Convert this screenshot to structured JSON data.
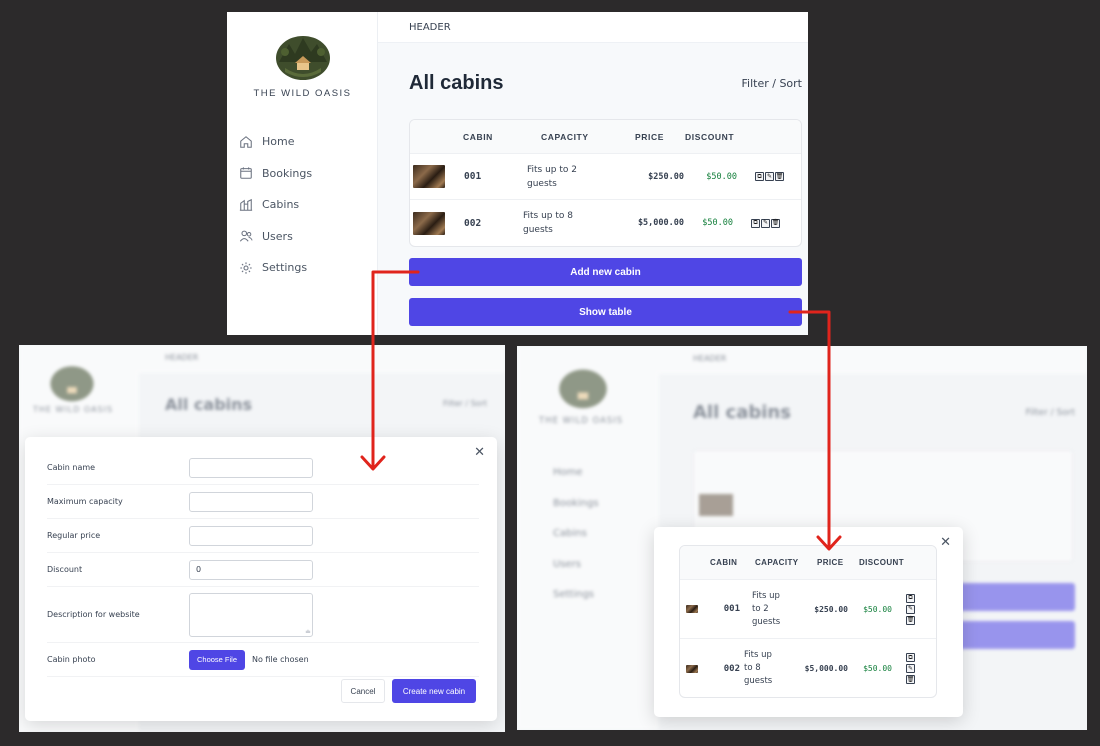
{
  "app": {
    "header": "HEADER",
    "logo_text": "THE WILD OASIS"
  },
  "nav": [
    {
      "label": "Home",
      "icon": "home-icon"
    },
    {
      "label": "Bookings",
      "icon": "calendar-icon"
    },
    {
      "label": "Cabins",
      "icon": "building-icon"
    },
    {
      "label": "Users",
      "icon": "users-icon"
    },
    {
      "label": "Settings",
      "icon": "gear-icon"
    }
  ],
  "page": {
    "title": "All cabins",
    "filter_sort": "Filter / Sort"
  },
  "table": {
    "headers": [
      "CABIN",
      "CAPACITY",
      "PRICE",
      "DISCOUNT"
    ],
    "rows": [
      {
        "cabin": "001",
        "capacity": "Fits up to 2 guests",
        "price": "$250.00",
        "discount": "$50.00"
      },
      {
        "cabin": "002",
        "capacity": "Fits up to 8 guests",
        "price": "$5,000.00",
        "discount": "$50.00"
      }
    ]
  },
  "buttons": {
    "add_cabin": "Add new cabin",
    "show_table": "Show table"
  },
  "form": {
    "labels": {
      "name": "Cabin name",
      "capacity": "Maximum capacity",
      "price": "Regular price",
      "discount": "Discount",
      "description": "Description for website",
      "photo": "Cabin photo"
    },
    "discount_value": "0",
    "choose_file": "Choose File",
    "no_file": "No file chosen",
    "cancel": "Cancel",
    "submit": "Create new cabin"
  },
  "modal_table": {
    "rows": [
      {
        "cabin": "001",
        "capacity_lines": [
          "Fits up",
          "to 2",
          "guests"
        ],
        "price": "$250.00",
        "discount": "$50.00"
      },
      {
        "cabin": "002",
        "capacity_lines": [
          "Fits up",
          "to 8",
          "guests"
        ],
        "price": "$5,000.00",
        "discount": "$50.00"
      }
    ]
  },
  "colors": {
    "accent": "#4f46e5",
    "arrow": "#e0241c",
    "discount": "#15803d",
    "backdrop": "#2c2a2b"
  }
}
